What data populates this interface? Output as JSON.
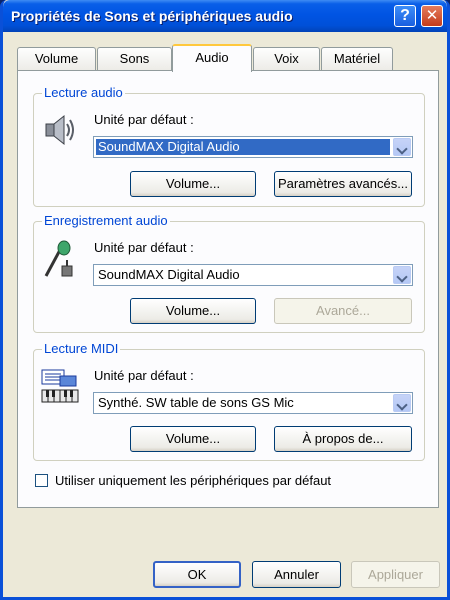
{
  "window": {
    "title": "Propriétés de Sons et périphériques audio",
    "help_label": "?",
    "close_label": "✕"
  },
  "tabs": [
    {
      "label": "Volume"
    },
    {
      "label": "Sons"
    },
    {
      "label": "Audio",
      "active": true
    },
    {
      "label": "Voix"
    },
    {
      "label": "Matériel"
    }
  ],
  "playback": {
    "group_label": "Lecture audio",
    "icon": "speaker-icon",
    "device_label": "Unité par défaut :",
    "device_value": "SoundMAX Digital Audio",
    "volume_button": "Volume...",
    "advanced_button": "Paramètres avancés..."
  },
  "recording": {
    "group_label": "Enregistrement audio",
    "icon": "microphone-icon",
    "device_label": "Unité par défaut :",
    "device_value": "SoundMAX Digital Audio",
    "volume_button": "Volume...",
    "advanced_button": "Avancé..."
  },
  "midi": {
    "group_label": "Lecture MIDI",
    "icon": "midi-keyboard-icon",
    "device_label": "Unité par défaut :",
    "device_value": "Synthé. SW table de sons GS Mic",
    "volume_button": "Volume...",
    "about_button": "À propos de..."
  },
  "default_only": {
    "label": "Utiliser uniquement les périphériques par défaut",
    "checked": false
  },
  "footer": {
    "ok": "OK",
    "cancel": "Annuler",
    "apply": "Appliquer"
  },
  "colors": {
    "titlebar": "#0054e3",
    "group_label": "#0046d5",
    "selection": "#316ac5",
    "tab_highlight": "#ffc83c"
  }
}
